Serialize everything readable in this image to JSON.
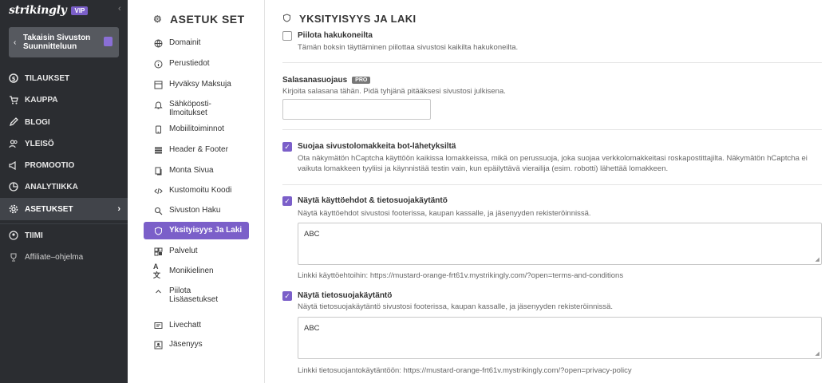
{
  "brand": {
    "name": "strikingly",
    "badge": "VIP"
  },
  "sidebar": {
    "back_label": "Takaisin Sivuston\nSuunnittelu​un",
    "items": [
      {
        "label": "TILAUKSET",
        "icon": "dollar-circle-icon"
      },
      {
        "label": "KAUPPA",
        "icon": "cart-icon"
      },
      {
        "label": "BLOGI",
        "icon": "pen-icon"
      },
      {
        "label": "YLEISÖ",
        "icon": "people-icon"
      },
      {
        "label": "PROMOOTIO",
        "icon": "megaphone-icon"
      },
      {
        "label": "ANALYTIIKKA",
        "icon": "chart-icon"
      },
      {
        "label": "ASETUKSET",
        "icon": "gear-icon"
      },
      {
        "label": "TIIMI",
        "icon": "team-icon"
      },
      {
        "label": "Affiliate–ohjelma",
        "icon": "trophy-icon"
      }
    ]
  },
  "settings": {
    "title": "ASETUK SET",
    "items": [
      {
        "label": "Domainit",
        "icon": "globe-icon"
      },
      {
        "label": "Perustiedot",
        "icon": "info-icon"
      },
      {
        "label": "Hyväksy Maksuja",
        "icon": "payment-icon"
      },
      {
        "label": "Sähköposti-\nIlmoitukset",
        "icon": "bell-icon"
      },
      {
        "label": "Mobiilitoiminnot",
        "icon": "mobile-icon"
      },
      {
        "label": "Header & Footer",
        "icon": "header-footer-icon"
      },
      {
        "label": "Monta Sivua",
        "icon": "pages-icon"
      },
      {
        "label": "Kustomoitu Koodi",
        "icon": "code-icon"
      },
      {
        "label": "Sivuston Haku",
        "icon": "search-icon"
      },
      {
        "label": "Yksityisyys Ja Laki",
        "icon": "shield-icon"
      },
      {
        "label": "Palvelut",
        "icon": "grid-icon"
      },
      {
        "label": "Monikielinen",
        "icon": "translate-icon"
      },
      {
        "label": "Piilota\nLisäasetukset",
        "icon": "chevron-up-icon"
      },
      {
        "label": "Livechatt",
        "icon": "chat-icon"
      },
      {
        "label": "Jäsenyys",
        "icon": "membership-icon"
      }
    ]
  },
  "main": {
    "title": "YKSITYISYYS JA LAKI",
    "hide_search": {
      "title": "Piilota hakukoneilta",
      "desc": "Tämän boksin täyttäminen piilottaa sivustosi kaikilta hakukoneilta.",
      "checked": false
    },
    "password": {
      "title": "Salasanasuojaus",
      "badge": "PRO",
      "desc": "Kirjoita salasana tähän. Pidä tyhjänä pitääksesi sivustosi julkisena.",
      "value": ""
    },
    "captcha": {
      "title": "Suojaa sivustolomakkeita bot-lähetyksiltä",
      "desc": "Ota näkymätön hCaptcha käyttöön kaikissa lomakkeissa, mikä on perussuoja, joka suojaa verkkolomakkeitasi roskapostittajilta. Näkymätön hCaptcha ei vaikuta lomakkeen tyyliisi ja käynnistää testin vain, kun epäilyttävä vierailija (esim. robotti) lähettää lomakkeen.",
      "checked": true
    },
    "terms": {
      "title": "Näytä käyttöehdot & tietosuojakäytäntö",
      "desc": "Näytä käyttöehdot sivustosi footerissa, kaupan kassalle, ja jäsenyyden rekisteröinnissä.",
      "checked": true,
      "text": "ABC",
      "link": "Linkki käyttöehtoihin: https://mustard-orange-frt61v.mystrikingly.com/?open=terms-and-conditions"
    },
    "privacy": {
      "title": "Näytä tietosuojakäytäntö",
      "desc": "Näytä tietosuojakäytäntö sivustosi footerissa, kaupan kassalle, ja jäsenyyden rekisteröinnissä.",
      "checked": true,
      "text": "ABC",
      "link": "Linkki tietosuojantokäytäntöön: https://mustard-orange-frt61v.mystrikingly.com/?open=privacy-policy"
    }
  },
  "colors": {
    "accent": "#7b5fc9",
    "sidebar_bg": "#2b2d31"
  }
}
